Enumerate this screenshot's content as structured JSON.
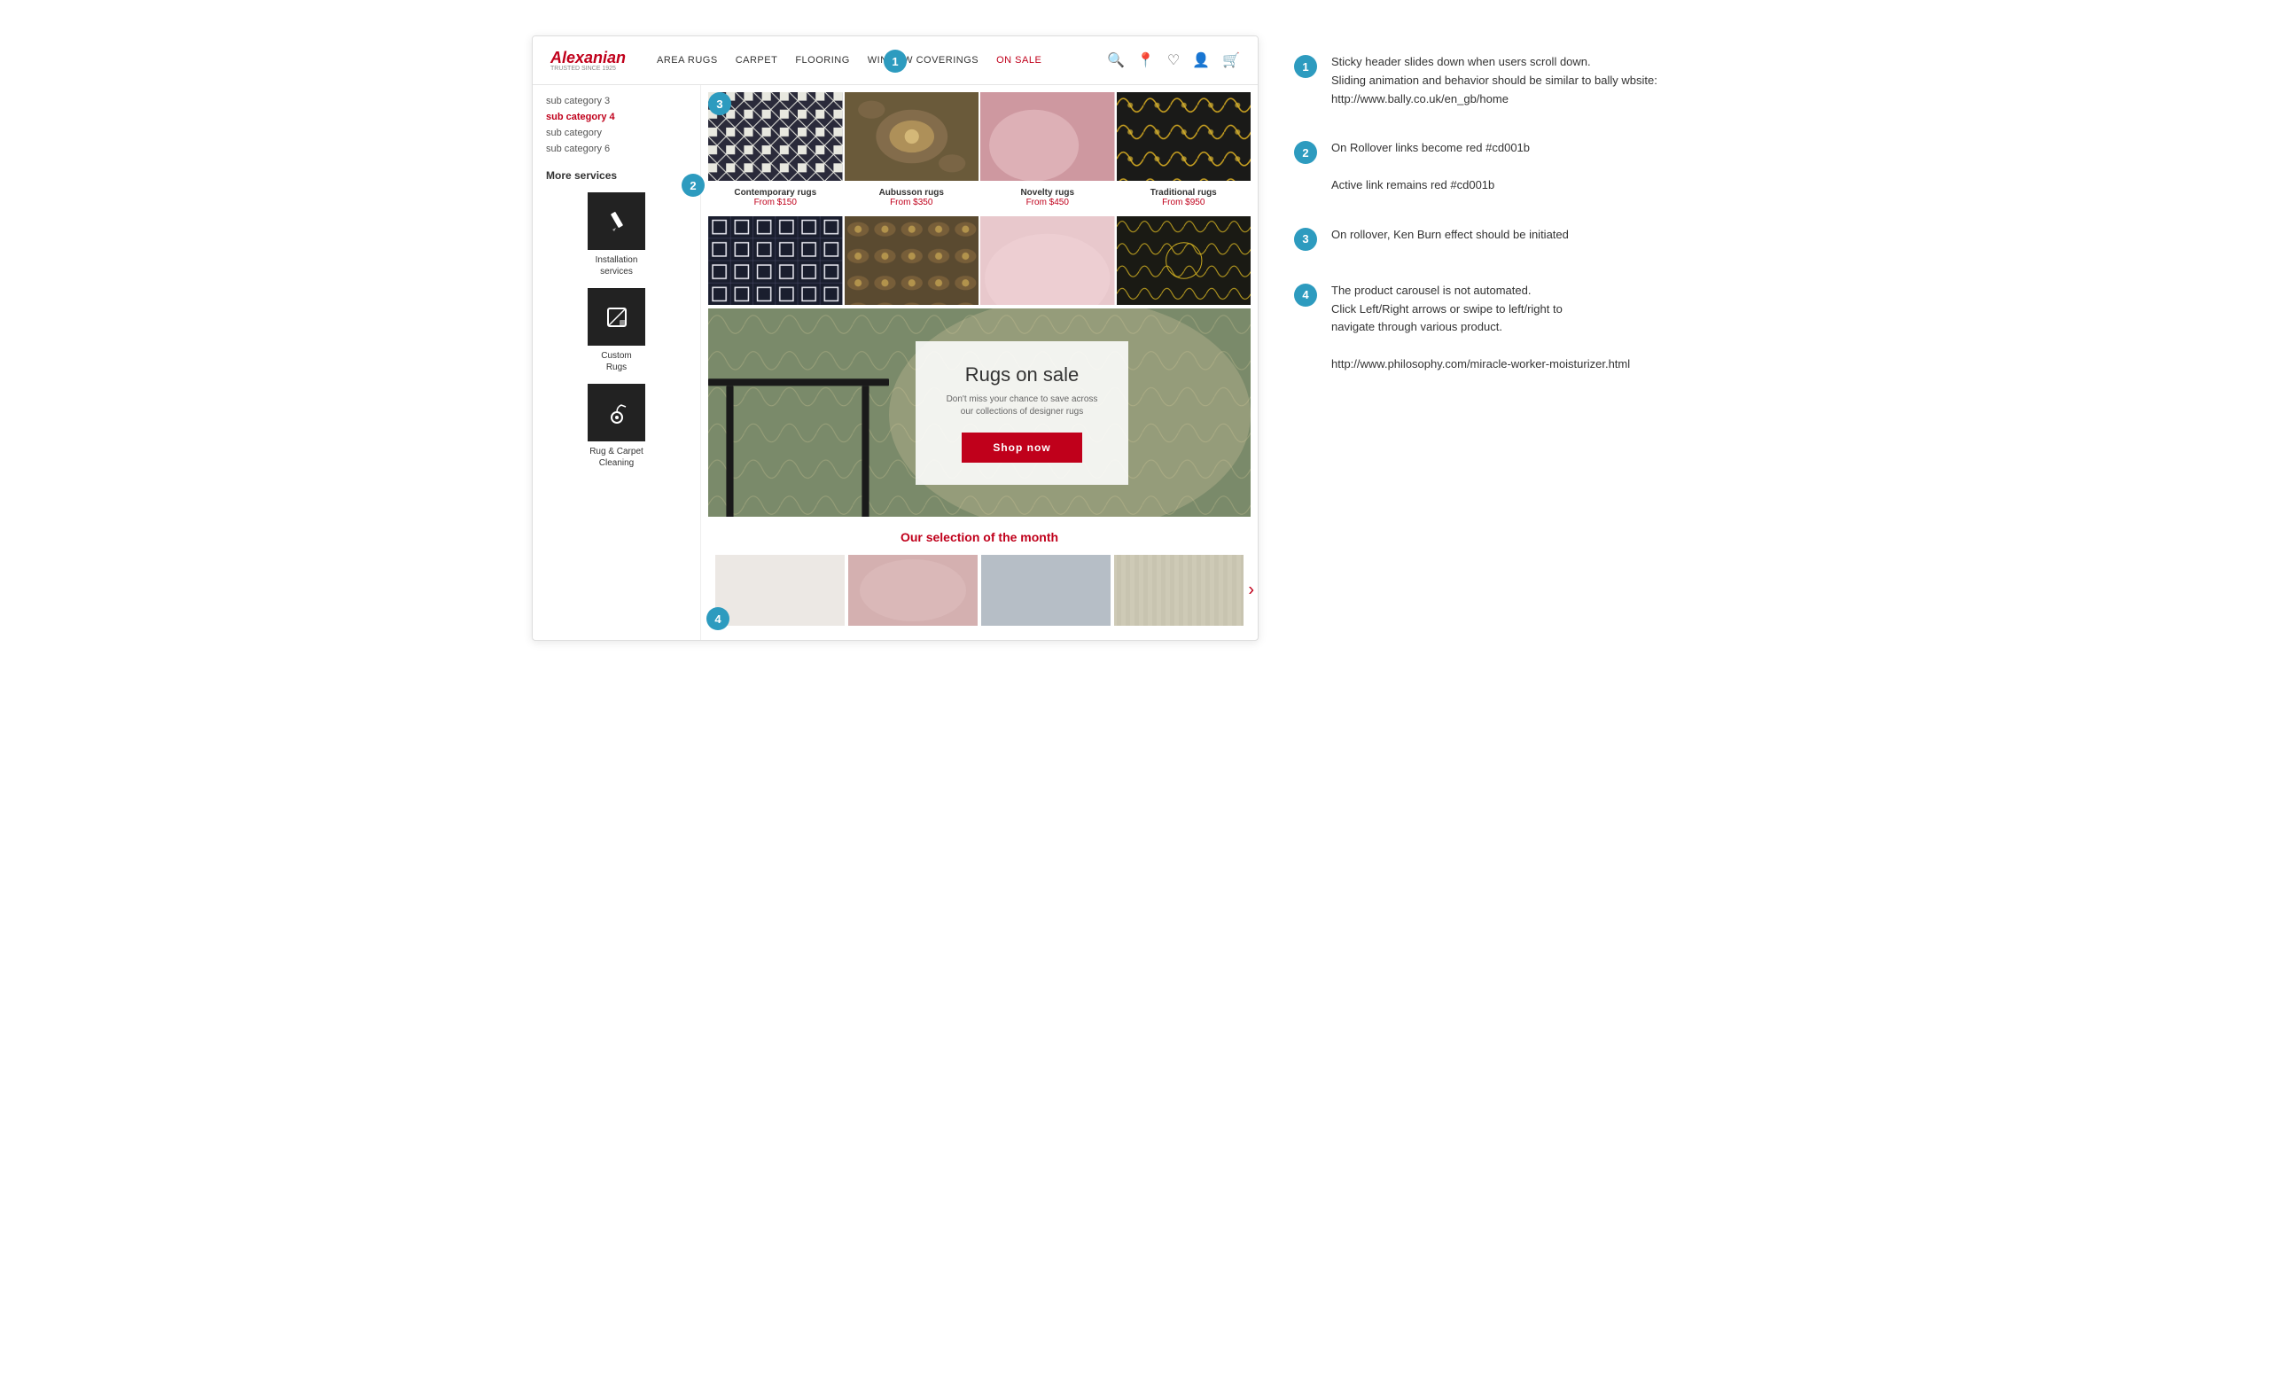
{
  "header": {
    "logo_text": "Alexanian",
    "logo_tagline": "TRUSTED SINCE 1925",
    "nav": [
      {
        "label": "AREA RUGS",
        "active": false
      },
      {
        "label": "CARPET",
        "active": false
      },
      {
        "label": "FLOORING",
        "active": false
      },
      {
        "label": "WINDOW COVERINGS",
        "active": false
      },
      {
        "label": "ON SALE",
        "active": false,
        "sale": true
      }
    ]
  },
  "sidebar": {
    "links": [
      {
        "label": "sub category 3",
        "active": false
      },
      {
        "label": "sub category 4",
        "active": true
      },
      {
        "label": "sub category",
        "active": false
      },
      {
        "label": "sub category 6",
        "active": false
      }
    ],
    "more_services_title": "More services",
    "services": [
      {
        "label": "Installation\nservices",
        "icon": "pencil"
      },
      {
        "label": "Custom\nRugs",
        "icon": "corner"
      },
      {
        "label": "Rug & Carpet\nCleaning",
        "icon": "vacuum"
      }
    ]
  },
  "rug_grid": {
    "items": [
      {
        "name": "Contemporary rugs",
        "price": "From $150",
        "color1": "#2a2a3a",
        "color2": "#e8e8e0"
      },
      {
        "name": "Aubusson rugs",
        "price": "From $350",
        "color1": "#5a4a2a",
        "color2": "#c8b890"
      },
      {
        "name": "Novelty rugs",
        "price": "From $450",
        "color1": "#c8a0a0",
        "color2": "#e8c0c0"
      },
      {
        "name": "Traditional rugs",
        "price": "From $950",
        "color1": "#1a1a1a",
        "color2": "#c8a830"
      }
    ]
  },
  "sale_banner": {
    "title": "Rugs on sale",
    "description": "Don't miss your chance to save across\nour collections of designer rugs",
    "button_label": "Shop now"
  },
  "selection": {
    "title": "Our selection ",
    "title_highlight": "of the month",
    "items": [
      {
        "color": "#e8e4e0"
      },
      {
        "color": "#d4b0b0"
      },
      {
        "color": "#b0b8c0"
      },
      {
        "color": "#c8c4b0"
      }
    ]
  },
  "annotations": [
    {
      "number": "1",
      "text": "Sticky header slides down when users scroll down.\nSliding animation and behavior should be similar to bally wbsite:\nhttp://www.bally.co.uk/en_gb/home"
    },
    {
      "number": "2",
      "text": "On Rollover links become red #cd001b\n\nActive link remains red #cd001b"
    },
    {
      "number": "3",
      "text": "On rollover, Ken Burn effect should be initiated"
    },
    {
      "number": "4",
      "text": "The product carousel is not automated.\nClick Left/Right arrows or swipe to left/right to\nnavigate through various product.\n\nhttp://www.philosophy.com/miracle-worker-moisturizer.html"
    }
  ]
}
